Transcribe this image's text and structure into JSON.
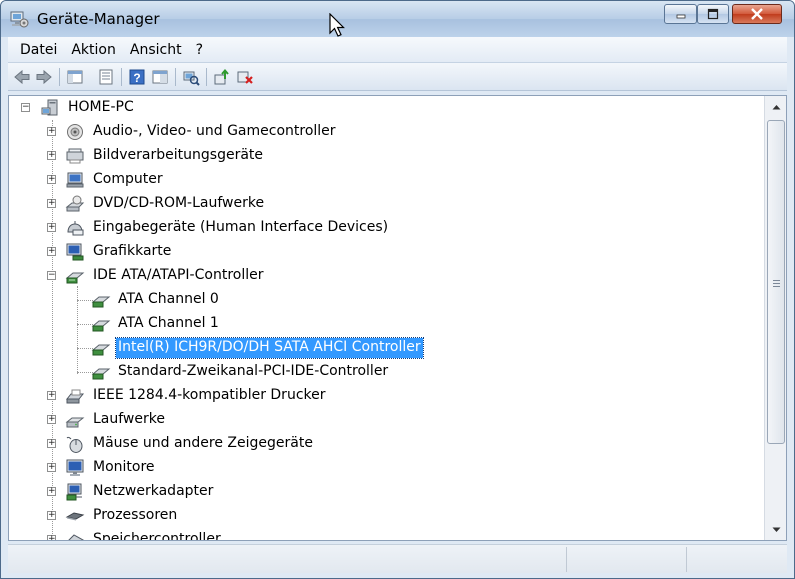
{
  "window": {
    "title": "Geräte-Manager",
    "icon": "device-manager-icon"
  },
  "titlebar_buttons": {
    "minimize_icon": "minimize-icon",
    "maximize_icon": "maximize-icon",
    "close_icon": "close-icon"
  },
  "menu": {
    "items": [
      "Datei",
      "Aktion",
      "Ansicht",
      "?"
    ]
  },
  "toolbar": {
    "buttons": [
      "back-arrow-icon",
      "forward-arrow-icon",
      "console-tree-icon",
      "properties-icon",
      "help-icon",
      "show-view-icon",
      "scan-hardware-icon",
      "update-driver-icon",
      "uninstall-icon"
    ]
  },
  "tree": {
    "root": "HOME-PC",
    "items": [
      {
        "label": "Audio-, Video- und Gamecontroller",
        "icon": "audio-icon",
        "expanded": false
      },
      {
        "label": "Bildverarbeitungsgeräte",
        "icon": "scanner-icon",
        "expanded": false
      },
      {
        "label": "Computer",
        "icon": "computer-icon",
        "expanded": false
      },
      {
        "label": "DVD/CD-ROM-Laufwerke",
        "icon": "cdrom-icon",
        "expanded": false
      },
      {
        "label": "Eingabegeräte (Human Interface Devices)",
        "icon": "hid-icon",
        "expanded": false
      },
      {
        "label": "Grafikkarte",
        "icon": "display-adapter-icon",
        "expanded": false
      },
      {
        "label": "IDE ATA/ATAPI-Controller",
        "icon": "ide-controller-icon",
        "expanded": true
      },
      {
        "label": "IEEE 1284.4-kompatibler Drucker",
        "icon": "printer-icon",
        "expanded": false
      },
      {
        "label": "Laufwerke",
        "icon": "disk-drive-icon",
        "expanded": false
      },
      {
        "label": "Mäuse und andere Zeigegeräte",
        "icon": "mouse-icon",
        "expanded": false
      },
      {
        "label": "Monitore",
        "icon": "monitor-icon",
        "expanded": false
      },
      {
        "label": "Netzwerkadapter",
        "icon": "network-adapter-icon",
        "expanded": false
      },
      {
        "label": "Prozessoren",
        "icon": "processor-icon",
        "expanded": false
      },
      {
        "label": "Speichercontroller",
        "icon": "storage-controller-icon",
        "expanded": false
      }
    ],
    "ide_children": [
      {
        "label": "ATA Channel 0",
        "icon": "ide-channel-icon",
        "selected": false
      },
      {
        "label": "ATA Channel 1",
        "icon": "ide-channel-icon",
        "selected": false
      },
      {
        "label": "Intel(R) ICH9R/DO/DH SATA AHCI Controller",
        "icon": "ide-channel-icon",
        "selected": true
      },
      {
        "label": "Standard-Zweikanal-PCI-IDE-Controller",
        "icon": "ide-channel-icon",
        "selected": false
      }
    ]
  },
  "colors": {
    "selection": "#3399ff",
    "titlebar": "#b7cde6",
    "close_button": "#c03c1d"
  }
}
